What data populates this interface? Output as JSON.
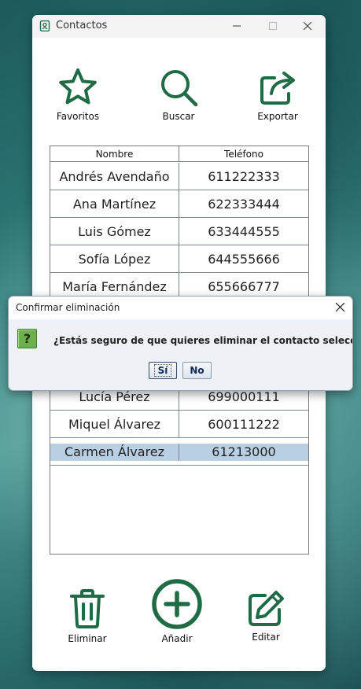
{
  "window": {
    "title": "Contactos"
  },
  "toolbar": {
    "favorites_label": "Favoritos",
    "search_label": "Buscar",
    "export_label": "Exportar"
  },
  "table": {
    "columns": [
      "Nombre",
      "Teléfono"
    ],
    "rows": [
      {
        "name": "Andrés Avendaño",
        "phone": "611222333"
      },
      {
        "name": "Ana Martínez",
        "phone": "622333444"
      },
      {
        "name": "Luis Gómez",
        "phone": "633444555"
      },
      {
        "name": "Sofía López",
        "phone": "644555666"
      },
      {
        "name": "María Fernández",
        "phone": "655666777"
      },
      {
        "name": "Lucía Pérez",
        "phone": "699000111"
      },
      {
        "name": "Miquel Álvarez",
        "phone": "600111222"
      },
      {
        "name": "Carmen Álvarez",
        "phone": "61213000"
      }
    ]
  },
  "actions": {
    "delete_label": "Eliminar",
    "add_label": "Añadir",
    "edit_label": "Editar"
  },
  "dialog": {
    "title": "Confirmar eliminación",
    "message": "¿Estás seguro de que quieres eliminar el contacto seleccionado?",
    "yes_label": "Sí",
    "no_label": "No",
    "icon": "question-icon"
  },
  "colors": {
    "accent_green": "#1e6b45",
    "selection": "#b8cfe4"
  }
}
